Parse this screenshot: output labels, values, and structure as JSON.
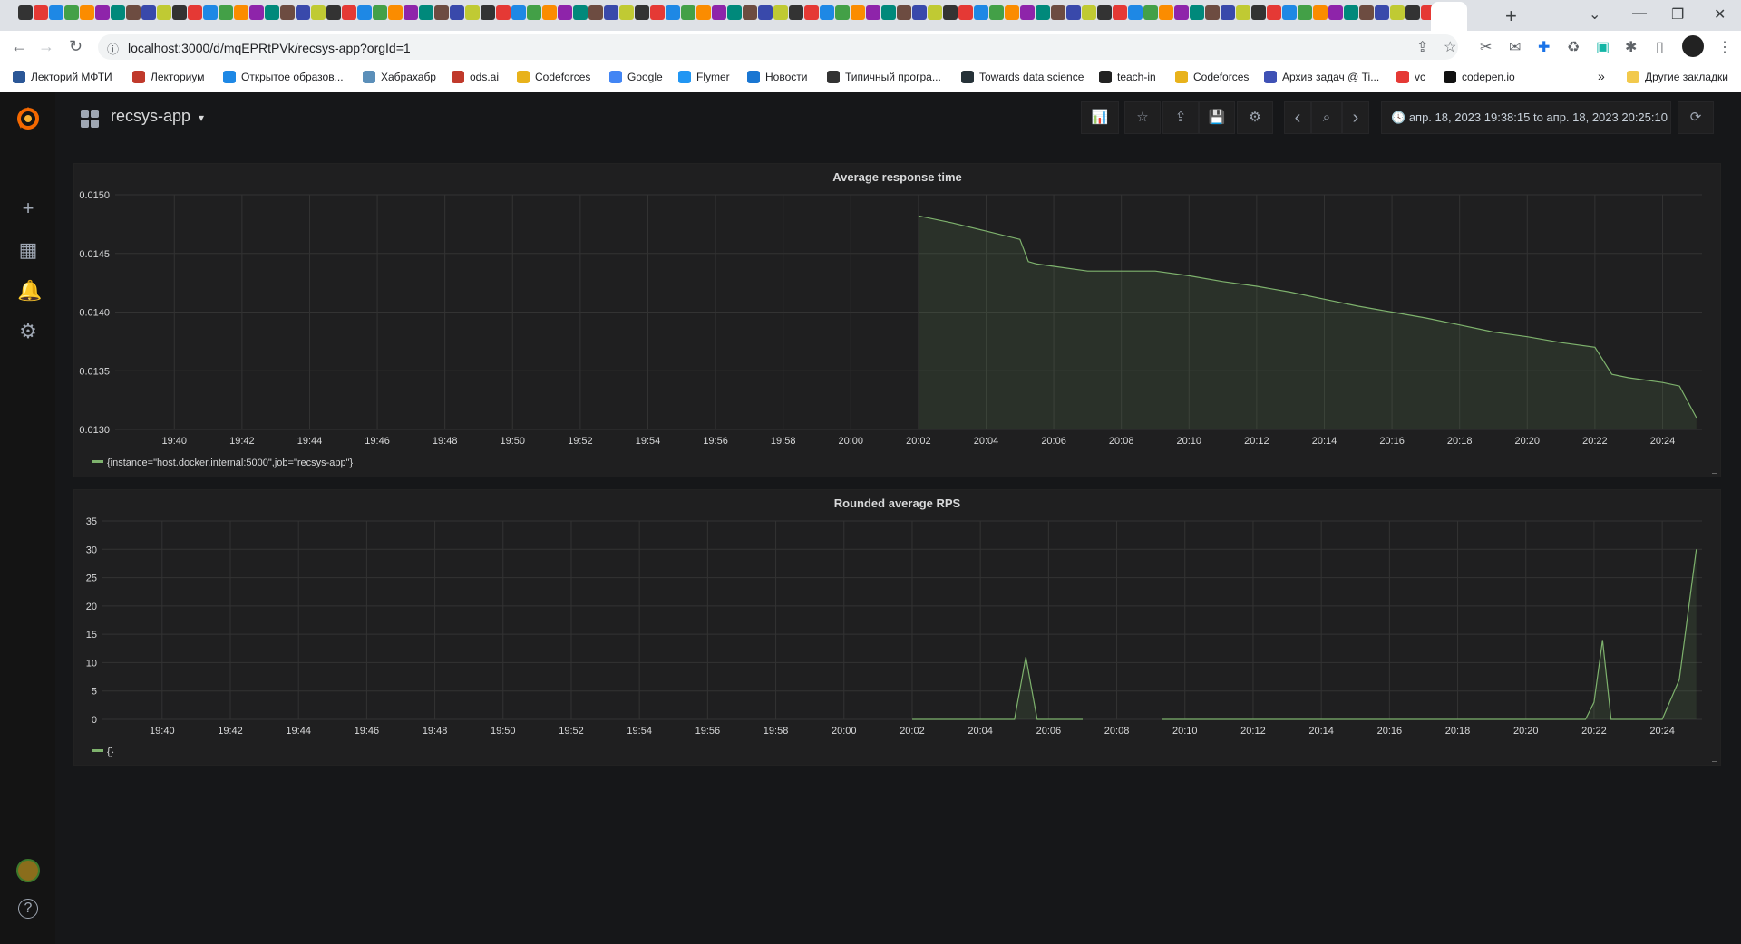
{
  "browser": {
    "url": "localhost:3000/d/mqEPRtPVk/recsys-app?orgId=1",
    "bookmarks": [
      {
        "label": "Лекторий МФТИ",
        "color": "#2b5797"
      },
      {
        "label": "Лекториум",
        "color": "#c0392b"
      },
      {
        "label": "Открытое образов...",
        "color": "#1e88e5"
      },
      {
        "label": "Хабрахабр",
        "color": "#5b8fb9"
      },
      {
        "label": "ods.ai",
        "color": "#c0392b"
      },
      {
        "label": "Codeforces",
        "color": "#e8b21b"
      },
      {
        "label": "Google",
        "color": "#4285f4"
      },
      {
        "label": "Flymer",
        "color": "#2196f3"
      },
      {
        "label": "Новости",
        "color": "#1976d2"
      },
      {
        "label": "Типичный програ...",
        "color": "#333333"
      },
      {
        "label": "Towards data science",
        "color": "#263238"
      },
      {
        "label": "teach-in",
        "color": "#222222"
      },
      {
        "label": "Codeforces",
        "color": "#e8b21b"
      },
      {
        "label": "Архив задач @ Ti...",
        "color": "#3f51b5"
      },
      {
        "label": "vc",
        "color": "#e53935"
      },
      {
        "label": "codepen.io",
        "color": "#111111"
      }
    ],
    "more_bookmarks": "»",
    "other_bookmarks": "Другие закладки"
  },
  "sidebar": {
    "items": [
      {
        "name": "create-icon",
        "glyph": "+"
      },
      {
        "name": "dashboards-icon",
        "glyph": "▦"
      },
      {
        "name": "alerting-icon",
        "glyph": "🔔"
      },
      {
        "name": "configuration-icon",
        "glyph": "⚙"
      }
    ],
    "help_glyph": "?"
  },
  "dashboard": {
    "title": "recsys-app",
    "title_caret": "▾",
    "toolbar": {
      "add_panel": "📊",
      "star": "☆",
      "share": "⇪",
      "save": "💾",
      "settings": "⚙",
      "prev": "‹",
      "zoom_out": "⌕",
      "next": "›",
      "refresh": "⟳"
    },
    "time_range": "апр. 18, 2023 19:38:15 to апр. 18, 2023 20:25:10"
  },
  "panels": [
    {
      "title": "Average response time",
      "legend": "{instance=\"host.docker.internal:5000\",job=\"recsys-app\"}"
    },
    {
      "title": "Rounded average RPS",
      "legend": "{}"
    }
  ],
  "chart_data": [
    {
      "type": "area",
      "title": "Average response time",
      "xlabel": "",
      "ylabel": "",
      "x_ticks": [
        "19:40",
        "19:42",
        "19:44",
        "19:46",
        "19:48",
        "19:50",
        "19:52",
        "19:54",
        "19:56",
        "19:58",
        "20:00",
        "20:02",
        "20:04",
        "20:06",
        "20:08",
        "20:10",
        "20:12",
        "20:14",
        "20:16",
        "20:18",
        "20:20",
        "20:22",
        "20:24"
      ],
      "y_ticks": [
        "0.0130",
        "0.0135",
        "0.0140",
        "0.0145",
        "0.0150"
      ],
      "xlim": [
        "19:38:15",
        "20:25:10"
      ],
      "ylim": [
        0.013,
        0.015
      ],
      "grid": true,
      "legend_position": "bottom-left",
      "series": [
        {
          "name": "{instance=\"host.docker.internal:5000\",job=\"recsys-app\"}",
          "color": "#7eb26d",
          "x": [
            "20:02",
            "20:03",
            "20:04",
            "20:05",
            "20:05:15",
            "20:05:30",
            "20:06",
            "20:07",
            "20:08",
            "20:09",
            "20:10",
            "20:11",
            "20:12",
            "20:13",
            "20:14",
            "20:15",
            "20:16",
            "20:17",
            "20:18",
            "20:19",
            "20:20",
            "20:21",
            "20:22",
            "20:22:30",
            "20:23",
            "20:24",
            "20:24:30",
            "20:25"
          ],
          "values": [
            0.01482,
            0.01476,
            0.01469,
            0.01462,
            0.01443,
            0.01441,
            0.01439,
            0.01435,
            0.01435,
            0.01435,
            0.01431,
            0.01426,
            0.01422,
            0.01417,
            0.01411,
            0.01405,
            0.014,
            0.01395,
            0.01389,
            0.01383,
            0.01379,
            0.01374,
            0.0137,
            0.01347,
            0.01344,
            0.0134,
            0.01337,
            0.0131
          ]
        }
      ]
    },
    {
      "type": "line",
      "title": "Rounded average RPS",
      "xlabel": "",
      "ylabel": "",
      "x_ticks": [
        "19:40",
        "19:42",
        "19:44",
        "19:46",
        "19:48",
        "19:50",
        "19:52",
        "19:54",
        "19:56",
        "19:58",
        "20:00",
        "20:02",
        "20:04",
        "20:06",
        "20:08",
        "20:10",
        "20:12",
        "20:14",
        "20:16",
        "20:18",
        "20:20",
        "20:22",
        "20:24"
      ],
      "y_ticks": [
        "0",
        "5",
        "10",
        "15",
        "20",
        "25",
        "30",
        "35"
      ],
      "xlim": [
        "19:38:15",
        "20:25:10"
      ],
      "ylim": [
        0,
        35
      ],
      "grid": true,
      "legend_position": "bottom-left",
      "series": [
        {
          "name": "{}",
          "color": "#7eb26d",
          "segments": [
            {
              "x": [
                "20:02",
                "20:04:30",
                "20:05",
                "20:05:20",
                "20:05:40",
                "20:06",
                "20:07"
              ],
              "values": [
                0,
                0,
                0,
                11,
                0,
                0,
                0
              ]
            },
            {
              "x": [
                "20:09:20",
                "20:12",
                "20:16",
                "20:20",
                "20:21:45",
                "20:22",
                "20:22:15",
                "20:22:30",
                "20:24",
                "20:24:30",
                "20:25"
              ],
              "values": [
                0,
                0,
                0,
                0,
                0,
                3,
                14,
                0,
                0,
                7,
                30
              ]
            }
          ]
        }
      ]
    }
  ]
}
